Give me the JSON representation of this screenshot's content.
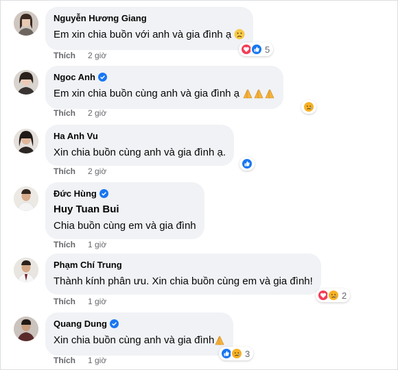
{
  "comments": [
    {
      "name": "Nguyễn Hương Giang",
      "verified": false,
      "text": "Em xin chia buồn với anh và gia đình ạ",
      "trailing_emoji": "sad-face",
      "like_label": "Thích",
      "time": "2 giờ",
      "reactions": [
        "love",
        "like"
      ],
      "reaction_count": "5"
    },
    {
      "name": "Ngoc Anh",
      "verified": true,
      "text": "Em xin chia buồn cùng anh và gia đình ạ",
      "trailing_emoji": "folded-hands-x3",
      "like_label": "Thích",
      "time": "2 giờ",
      "reactions": [
        "sad"
      ],
      "reaction_count": ""
    },
    {
      "name": "Ha Anh Vu",
      "verified": false,
      "text": "Xin chia buồn cùng anh và gia đình ạ.",
      "trailing_emoji": "",
      "like_label": "Thích",
      "time": "2 giờ",
      "reactions": [
        "like"
      ],
      "reaction_count": ""
    },
    {
      "name": "Đức Hùng",
      "verified": true,
      "tag": "Huy Tuan Bui",
      "text": "Chia buồn cùng em và gia đình",
      "trailing_emoji": "",
      "like_label": "Thích",
      "time": "1 giờ",
      "reactions": [],
      "reaction_count": ""
    },
    {
      "name": "Phạm Chí Trung",
      "verified": false,
      "text": "Thành kính phân ưu. Xin chia buồn cùng em và gia đình!",
      "trailing_emoji": "",
      "like_label": "Thích",
      "time": "1 giờ",
      "reactions": [
        "love",
        "sad"
      ],
      "reaction_count": "2"
    },
    {
      "name": "Quang Dung",
      "verified": true,
      "text": "Xin chia buồn cùng anh và gia đình",
      "trailing_emoji": "folded-hands",
      "like_label": "Thích",
      "time": "1 giờ",
      "reactions": [
        "like",
        "sad"
      ],
      "reaction_count": "3"
    }
  ],
  "colors": {
    "bubble": "#f0f2f5",
    "meta": "#65676b",
    "verified": "#1877f2",
    "like_reaction": "#1877f2",
    "love_reaction": "#f33e58",
    "sad_reaction": "#f7b125"
  }
}
